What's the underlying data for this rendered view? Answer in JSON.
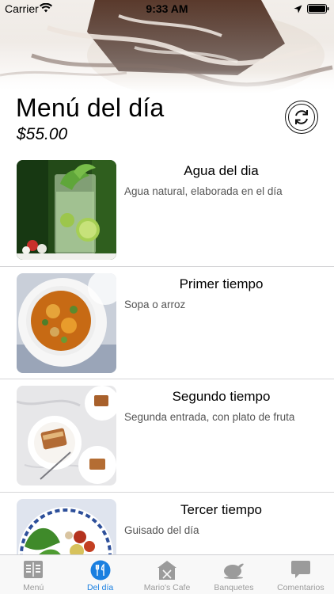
{
  "status_bar": {
    "carrier": "Carrier",
    "time": "9:33 AM"
  },
  "header": {
    "title": "Menú del día",
    "price": "$55.00",
    "refresh_icon": "refresh-icon"
  },
  "menu_items": [
    {
      "title": "Agua del dia",
      "description": "Agua natural, elaborada en el día",
      "image": "water-glass-image"
    },
    {
      "title": "Primer tiempo",
      "description": "Sopa o arroz",
      "image": "soup-bowl-image"
    },
    {
      "title": "Segundo tiempo",
      "description": "Segunda entrada, con plato de fruta",
      "image": "plated-dishes-image"
    },
    {
      "title": "Tercer tiempo",
      "description": "Guisado del día",
      "image": "stew-plate-image"
    }
  ],
  "tabs": [
    {
      "label": "Menú",
      "icon": "menu-book-icon",
      "active": false
    },
    {
      "label": "Del día",
      "icon": "utensils-icon",
      "active": true
    },
    {
      "label": "Mario's Cafe",
      "icon": "restaurant-icon",
      "active": false
    },
    {
      "label": "Banquetes",
      "icon": "roast-chicken-icon",
      "active": false
    },
    {
      "label": "Comentarios",
      "icon": "speech-bubble-icon",
      "active": false
    }
  ],
  "colors": {
    "accent": "#1a7fe0",
    "inactive_tab": "#9b9b9b",
    "separator": "#d6d6d8"
  }
}
